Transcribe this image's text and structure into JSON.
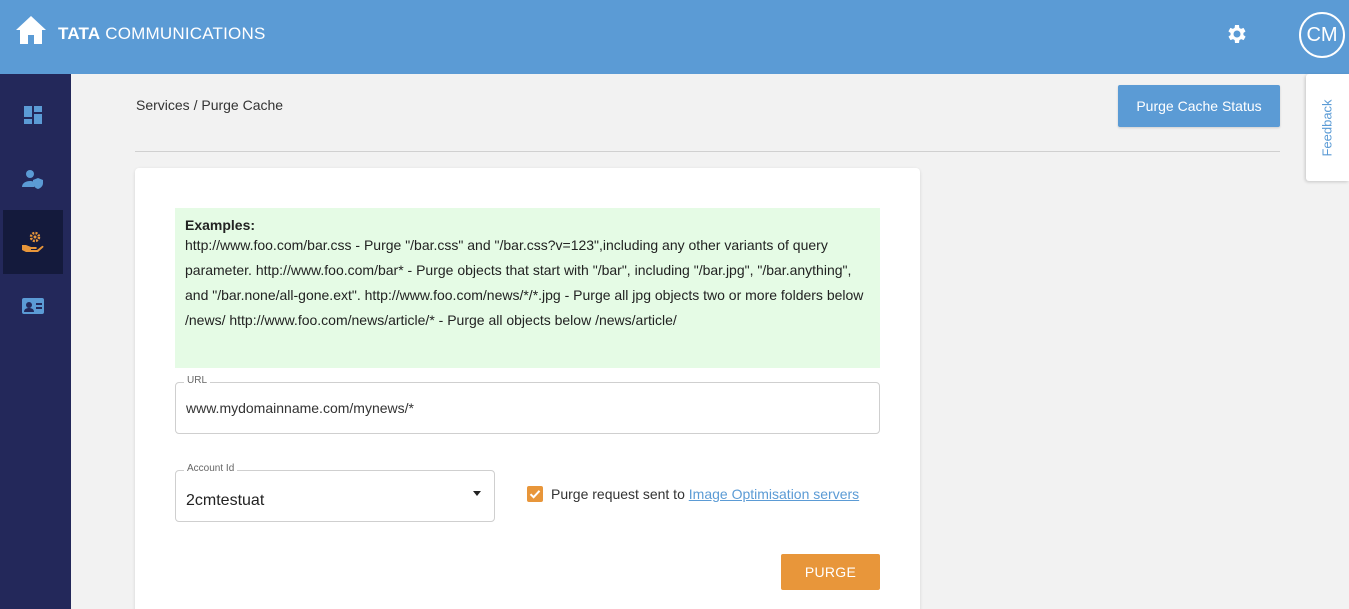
{
  "header": {
    "brand_bold": "TATA",
    "brand_rest": "COMMUNICATIONS",
    "avatar_initials": "CM",
    "color": "#5b9bd5"
  },
  "sidebar": {
    "color": "#23285a",
    "items": [
      {
        "icon": "dashboard-icon",
        "active": false
      },
      {
        "icon": "user-shield-icon",
        "active": false
      },
      {
        "icon": "hand-gear-icon",
        "active": true
      },
      {
        "icon": "contact-card-icon",
        "active": false
      }
    ]
  },
  "breadcrumb": "Services / Purge Cache",
  "actions": {
    "purge_cache_status": "Purge Cache Status"
  },
  "feedback": "Feedback",
  "examples": {
    "title": "Examples:",
    "body": "http://www.foo.com/bar.css - Purge \"/bar.css\" and \"/bar.css?v=123\",including any other variants of query parameter. http://www.foo.com/bar* - Purge objects that start with \"/bar\", including \"/bar.jpg\", \"/bar.anything\", and \"/bar.none/all-gone.ext\". http://www.foo.com/news/*/*.jpg - Purge all jpg objects two or more folders below /news/ http://www.foo.com/news/article/* - Purge all objects below /news/article/"
  },
  "form": {
    "url_label": "URL",
    "url_value": "www.mydomainname.com/mynews/*",
    "account_label": "Account Id",
    "account_value": "2cmtestuat",
    "checkbox_checked": true,
    "checkbox_text": "Purge request sent to ",
    "checkbox_link": "Image Optimisation servers",
    "purge_button": "PURGE"
  },
  "colors": {
    "accent_orange": "#e8963a",
    "examples_bg": "#e5fbe5"
  }
}
